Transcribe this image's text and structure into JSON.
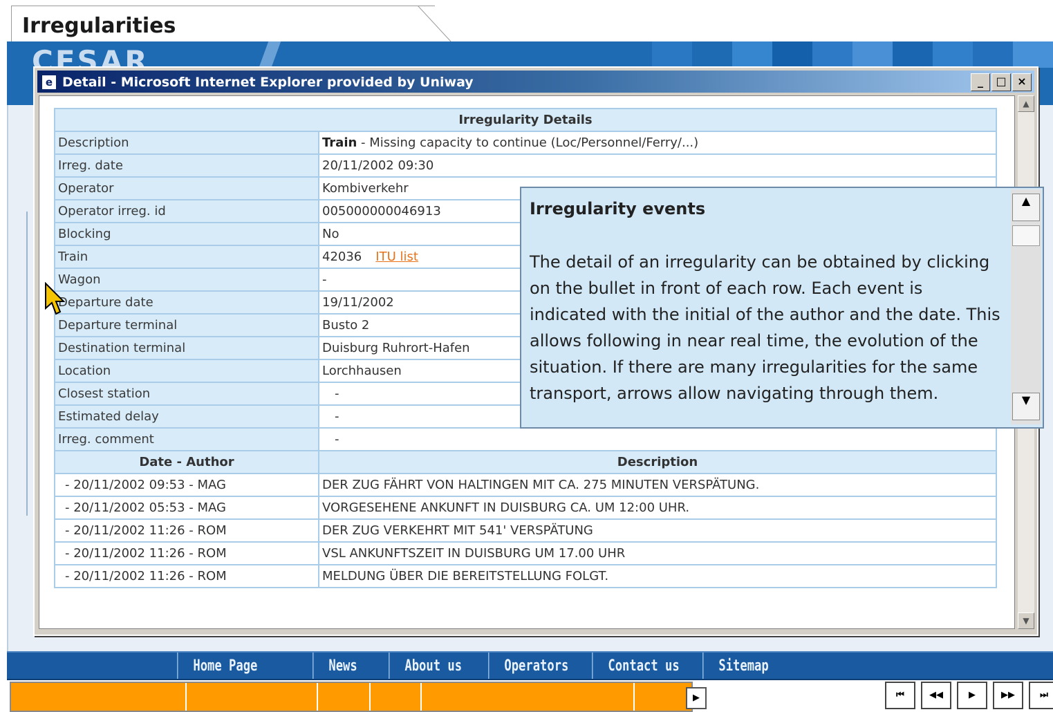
{
  "tab": {
    "title": "Irregularities"
  },
  "banner": {
    "logo": "CESAR",
    "tile_colors": [
      "#2a78c4",
      "#1e6ab3",
      "#3585cf",
      "#1560ab",
      "#2e7ac6",
      "#4a90d6",
      "#1b66b0",
      "#3080cc",
      "#2570bd",
      "#4791d8"
    ]
  },
  "ie": {
    "title": "Detail - Microsoft Internet Explorer provided by Uniway",
    "buttons": {
      "minimize": "_",
      "maximize": "□",
      "close": "×"
    }
  },
  "details": {
    "header": "Irregularity Details",
    "rows": [
      {
        "label": "Description",
        "value_bold": "Train",
        "value": " - Missing capacity to continue (Loc/Personnel/Ferry/...)"
      },
      {
        "label": "Irreg. date",
        "value": "20/11/2002 09:30"
      },
      {
        "label": "Operator",
        "value": "Kombiverkehr"
      },
      {
        "label": "Operator irreg. id",
        "value": "005000000046913"
      },
      {
        "label": "Blocking",
        "value": "No"
      },
      {
        "label": "Train",
        "value": "42036",
        "link": "ITU list"
      },
      {
        "label": "Wagon",
        "value": "-"
      },
      {
        "label": "Departure date",
        "value": "19/11/2002"
      },
      {
        "label": "Departure terminal",
        "value": "Busto 2"
      },
      {
        "label": "Destination terminal",
        "value": "Duisburg Ruhrort-Hafen"
      },
      {
        "label": "Location",
        "value": "Lorchhausen"
      },
      {
        "label": "Closest station",
        "value": "-"
      },
      {
        "label": "Estimated delay",
        "value": "-"
      },
      {
        "label": "Irreg. comment",
        "value": "-"
      }
    ]
  },
  "events": {
    "col_date": "Date - Author",
    "col_desc": "Description",
    "rows": [
      {
        "date": "- 20/11/2002 09:53 - MAG",
        "desc": "DER ZUG FÄHRT VON HALTINGEN MIT CA. 275 MINUTEN VERSPÄTUNG."
      },
      {
        "date": "- 20/11/2002 05:53 - MAG",
        "desc": "VORGESEHENE ANKUNFT IN DUISBURG CA. UM 12:00 UHR."
      },
      {
        "date": "- 20/11/2002 11:26 - ROM",
        "desc": "DER ZUG VERKEHRT MIT 541' VERSPÄTUNG"
      },
      {
        "date": "- 20/11/2002 11:26 - ROM",
        "desc": "VSL ANKUNFTSZEIT IN DUISBURG UM 17.00 UHR"
      },
      {
        "date": "- 20/11/2002 11:26 - ROM",
        "desc": "MELDUNG ÜBER DIE BEREITSTELLUNG FOLGT."
      }
    ]
  },
  "popup": {
    "title": "Irregularity events",
    "text": "The detail of an irregularity can be obtained by clicking on the bullet in front of each row. Each event is indicated with the initial of the author and the date. This allows following in near real time, the evolution of the situation. If there are many irregularities for the same transport, arrows allow navigating through them."
  },
  "nav": [
    "Home Page",
    "News",
    "About us",
    "Operators",
    "Contact us",
    "Sitemap"
  ],
  "pager": [
    "⏮",
    "◀◀",
    "▶",
    "▶▶",
    "⏭"
  ],
  "bottom_arrow": "▶"
}
